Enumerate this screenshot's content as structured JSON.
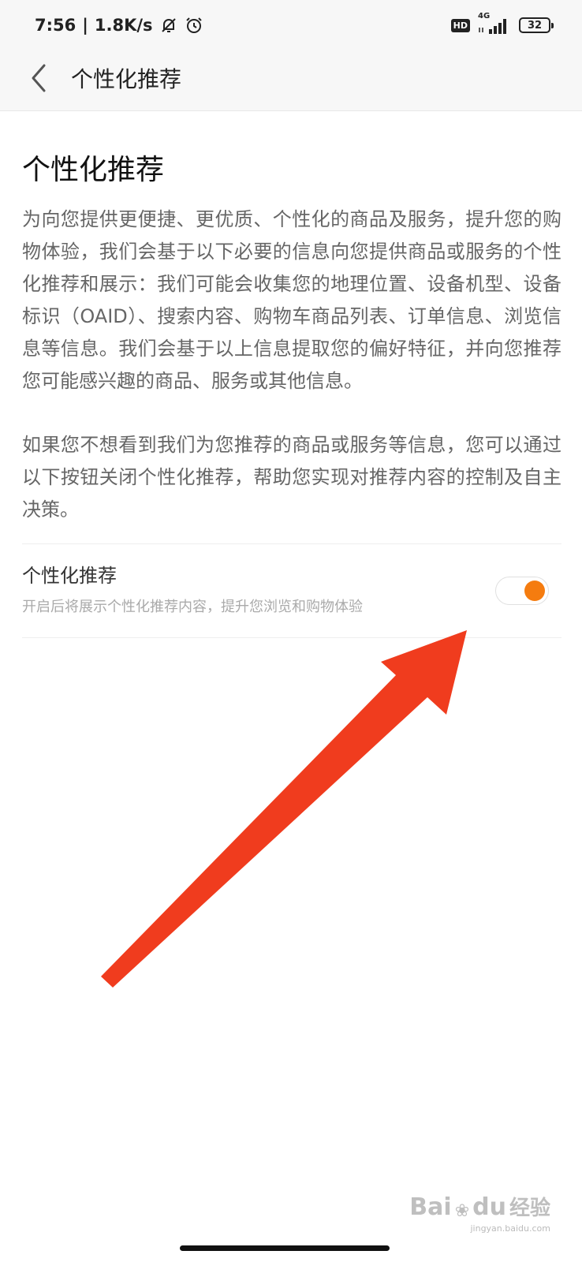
{
  "status_bar": {
    "time": "7:56",
    "separator": "|",
    "speed": "1.8K/s",
    "hd_badge": "HD",
    "network_type": "4G",
    "battery": "32",
    "icons": [
      "bell-muted-icon",
      "alarm-icon",
      "signal-icon",
      "battery-icon"
    ]
  },
  "nav": {
    "title": "个性化推荐"
  },
  "content": {
    "title": "个性化推荐",
    "paragraph1": "为向您提供更便捷、更优质、个性化的商品及服务，提升您的购物体验，我们会基于以下必要的信息向您提供商品或服务的个性化推荐和展示：我们可能会收集您的地理位置、设备机型、设备标识（OAID）、搜索内容、购物车商品列表、订单信息、浏览信息等信息。我们会基于以上信息提取您的偏好特征，并向您推荐您可能感兴趣的商品、服务或其他信息。",
    "paragraph2": "如果您不想看到我们为您推荐的商品或服务等信息，您可以通过以下按钮关闭个性化推荐，帮助您实现对推荐内容的控制及自主决策。"
  },
  "setting": {
    "label": "个性化推荐",
    "description": "开启后将展示个性化推荐内容，提升您浏览和购物体验",
    "enabled": true
  },
  "colors": {
    "accent": "#f57c0f",
    "arrow": "#f03c1e",
    "header_bg": "#f7f7f7"
  },
  "watermark": {
    "brand": "Bai",
    "brand2": "du",
    "brand_cn": "经验",
    "url": "jingyan.baidu.com"
  }
}
